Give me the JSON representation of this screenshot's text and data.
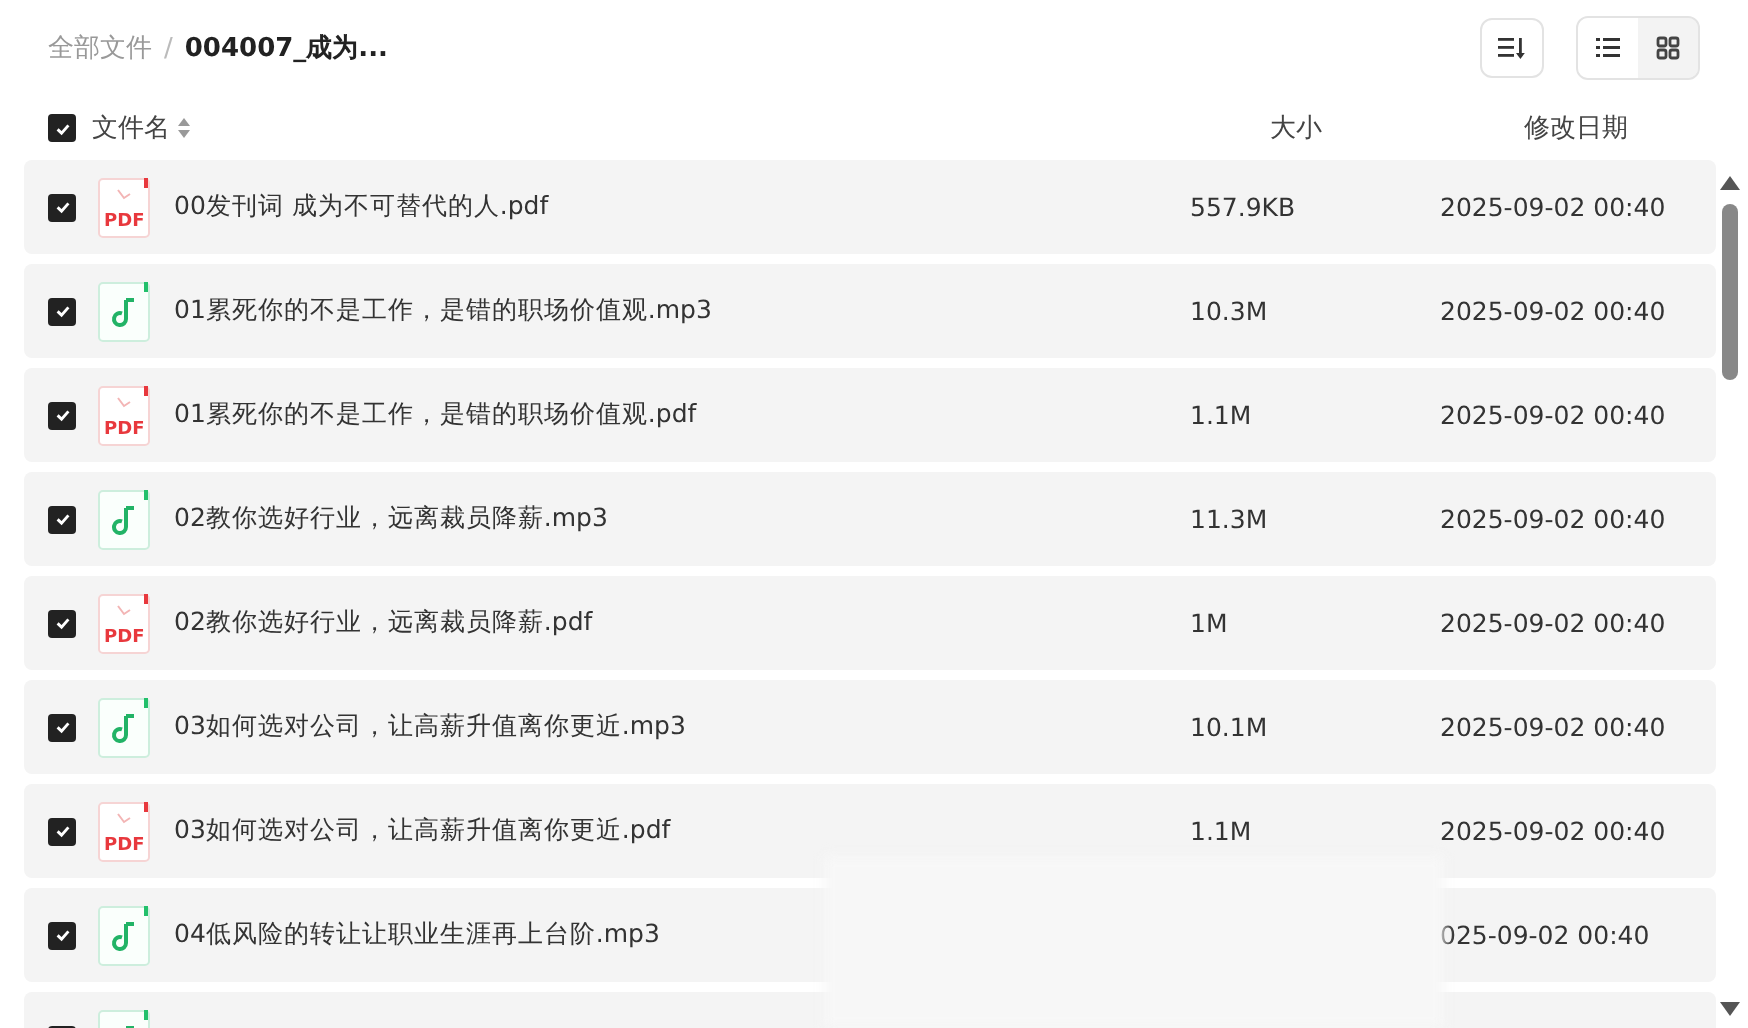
{
  "breadcrumb": {
    "root": "全部文件",
    "separator": "/",
    "current": "004007_成为..."
  },
  "toolbar": {
    "view_toggle": [
      {
        "kind": "list",
        "selected": true
      },
      {
        "kind": "grid",
        "selected": false
      }
    ]
  },
  "header": {
    "checked": true,
    "name": "文件名",
    "size": "大小",
    "date": "修改日期"
  },
  "rows": [
    {
      "kind": "pdf",
      "label": "PDF",
      "checked": true,
      "name": "00发刊词 成为不可替代的人.pdf",
      "size": "557.9KB",
      "date": "2025-09-02 00:40"
    },
    {
      "kind": "audio",
      "checked": true,
      "name": "01累死你的不是工作，是错的职场价值观.mp3",
      "size": "10.3M",
      "date": "2025-09-02 00:40"
    },
    {
      "kind": "pdf",
      "label": "PDF",
      "checked": true,
      "name": "01累死你的不是工作，是错的职场价值观.pdf",
      "size": "1.1M",
      "date": "2025-09-02 00:40"
    },
    {
      "kind": "audio",
      "checked": true,
      "name": "02教你选好行业，远离裁员降薪.mp3",
      "size": "11.3M",
      "date": "2025-09-02 00:40"
    },
    {
      "kind": "pdf",
      "label": "PDF",
      "checked": true,
      "name": "02教你选好行业，远离裁员降薪.pdf",
      "size": "1M",
      "date": "2025-09-02 00:40"
    },
    {
      "kind": "audio",
      "checked": true,
      "name": "03如何选对公司，让高薪升值离你更近.mp3",
      "size": "10.1M",
      "date": "2025-09-02 00:40"
    },
    {
      "kind": "pdf",
      "label": "PDF",
      "checked": true,
      "name": "03如何选对公司，让高薪升值离你更近.pdf",
      "size": "1.1M",
      "date": "2025-09-02 00:40"
    },
    {
      "kind": "audio",
      "checked": true,
      "name": "04低风险的转让让职业生涯再上台阶.mp3",
      "date": "025-09-02 00:40"
    },
    {
      "kind": "audio",
      "checked": true
    }
  ]
}
